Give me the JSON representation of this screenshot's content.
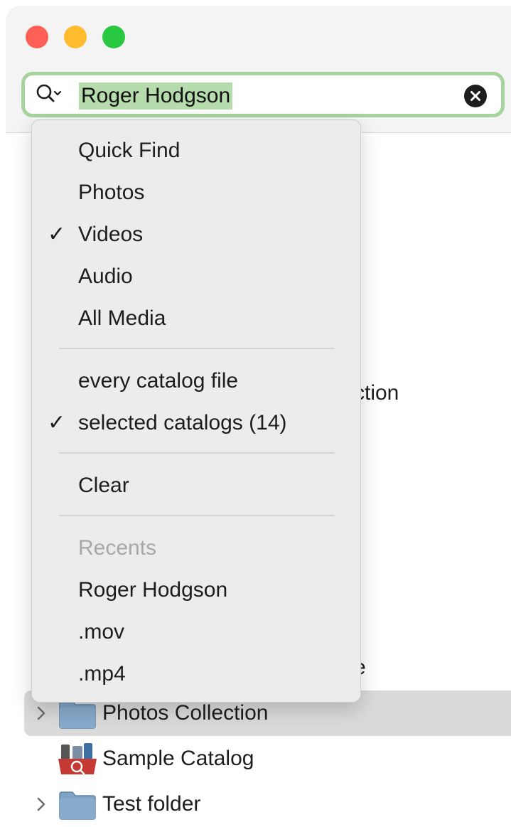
{
  "search": {
    "value": "Roger Hodgson"
  },
  "menu": {
    "kinds": [
      {
        "label": "Quick Find",
        "checked": false
      },
      {
        "label": "Photos",
        "checked": false
      },
      {
        "label": "Videos",
        "checked": true
      },
      {
        "label": "Audio",
        "checked": false
      },
      {
        "label": "All Media",
        "checked": false
      }
    ],
    "scope": [
      {
        "label": "every catalog file",
        "checked": false
      },
      {
        "label": "selected catalogs (14)",
        "checked": true
      }
    ],
    "clear_label": "Clear",
    "recents_header": "Recents",
    "recents": [
      "Roger Hodgson",
      ".mov",
      ".mp4"
    ],
    "check_glyph": "✓"
  },
  "background": {
    "peek_1": "ction",
    "peek_2": "e"
  },
  "sidebar": {
    "items": [
      {
        "label": "Photos Collection",
        "icon": "folder-icon",
        "selected": true,
        "expandable": true
      },
      {
        "label": "Sample Catalog",
        "icon": "catalog-icon",
        "selected": false,
        "expandable": false
      },
      {
        "label": "Test folder",
        "icon": "folder-icon",
        "selected": false,
        "expandable": true
      }
    ]
  },
  "colors": {
    "search_focus_ring": "#a6d49c",
    "search_selection": "#b6dcae",
    "close": "#fe5f57",
    "minimize": "#febc2e",
    "zoom": "#28c840",
    "selected_row": "#dadada",
    "folder_blue": "#7fa3c4"
  }
}
